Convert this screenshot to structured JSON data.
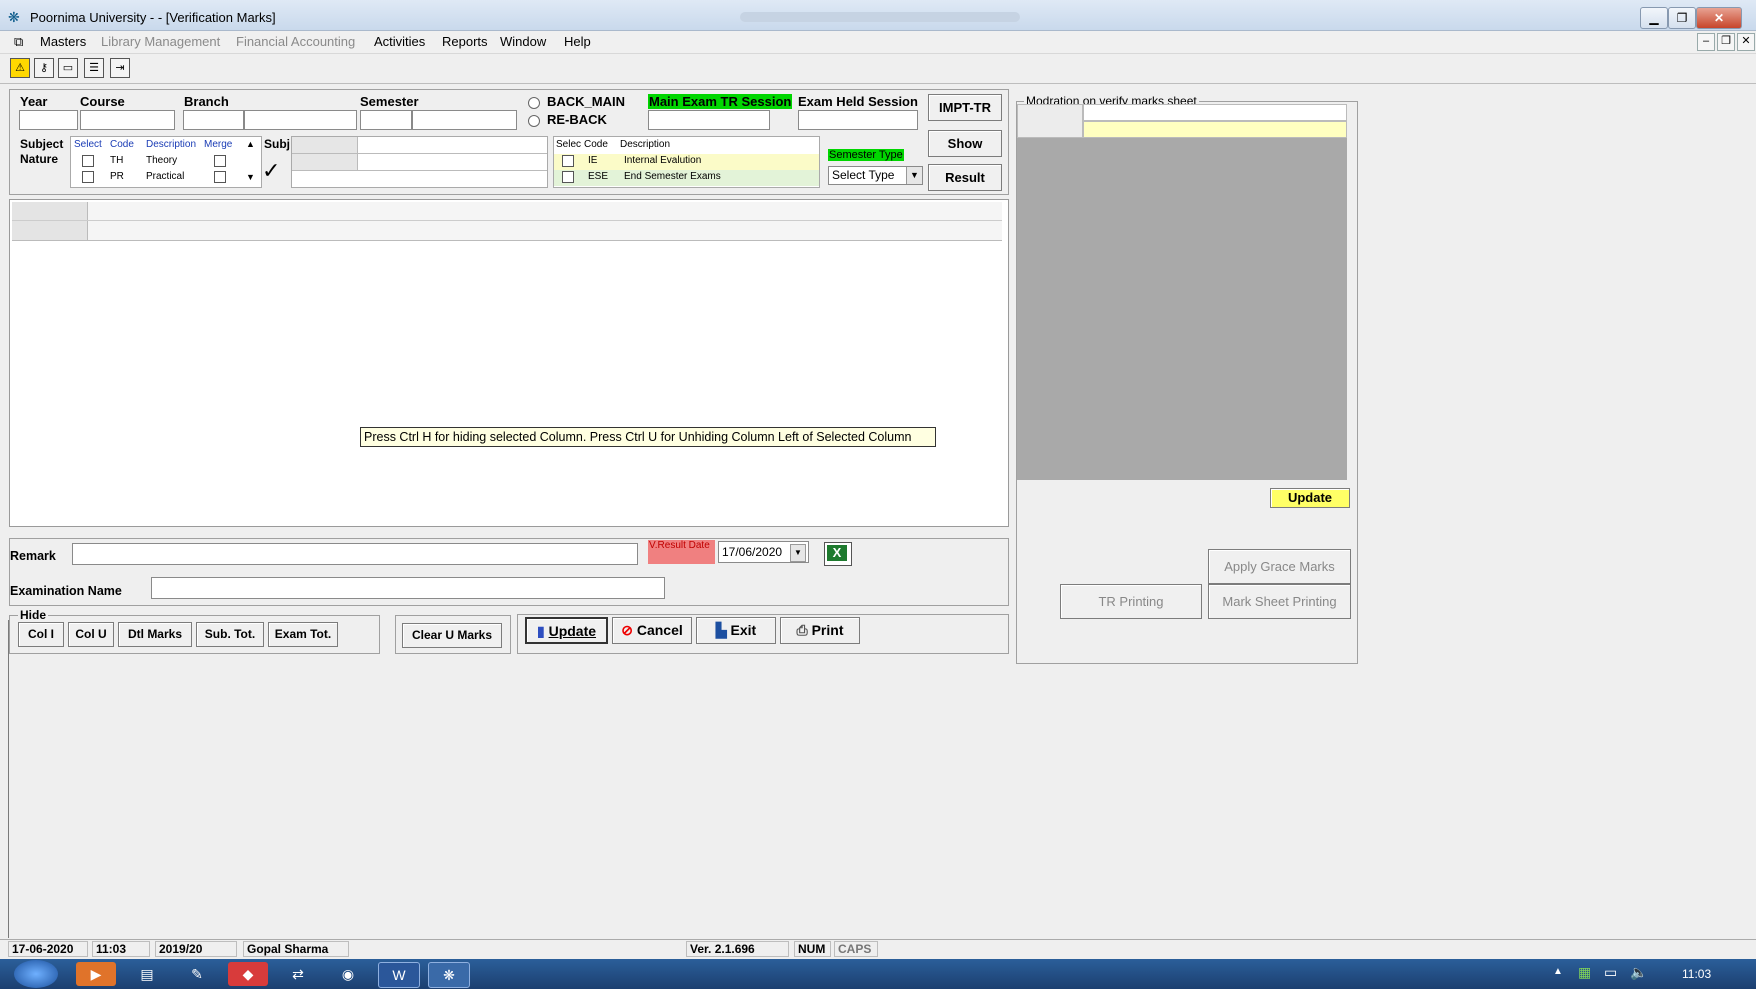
{
  "window": {
    "title": "Poornima University -  - [Verification Marks]"
  },
  "menu": [
    "Masters",
    "Library Management",
    "Financial Accounting",
    "Activities",
    "Reports",
    "Window",
    "Help"
  ],
  "filters": {
    "year_label": "Year",
    "course_label": "Course",
    "branch_label": "Branch",
    "semester_label": "Semester",
    "radio_back_main": "BACK_MAIN",
    "radio_re_back": "RE-BACK",
    "main_exam_session_label": "Main Exam TR Session",
    "exam_held_session_label": "Exam Held Session",
    "impt_tr_label": "IMPT-TR",
    "show_label": "Show",
    "result_label": "Result"
  },
  "subject_nature": {
    "label_line1": "Subject",
    "label_line2": "Nature",
    "headers": [
      "Select",
      "Code",
      "Description",
      "Merge"
    ],
    "rows": [
      {
        "code": "TH",
        "description": "Theory"
      },
      {
        "code": "PR",
        "description": "Practical"
      }
    ],
    "subj_label": "Subj"
  },
  "exam_type": {
    "headers": [
      "Selec",
      "Code",
      "Description"
    ],
    "rows": [
      {
        "code": "IE",
        "description": "Internal Evalution"
      },
      {
        "code": "ESE",
        "description": "End Semester Exams"
      }
    ]
  },
  "semester_type": {
    "label": "Semester Type",
    "value": "Select Type"
  },
  "hint": "Press Ctrl H for hiding selected Column.  Press Ctrl U for Unhiding Column Left of Selected Column",
  "remark": {
    "label": "Remark",
    "value": ""
  },
  "result_date": {
    "label": "V.Result Date",
    "value": "17/06/2020"
  },
  "exam_name": {
    "label": "Examination Name",
    "value": ""
  },
  "hide": {
    "label": "Hide",
    "buttons": [
      "Col I",
      "Col U",
      "Dtl Marks",
      "Sub. Tot.",
      "Exam Tot."
    ]
  },
  "clear_u_marks": "Clear U Marks",
  "actions": {
    "update": "Update",
    "cancel": "Cancel",
    "exit": "Exit",
    "print": "Print"
  },
  "moderation": {
    "title": "Modration on verify marks sheet",
    "update_label": "Update",
    "apply_grace": "Apply Grace Marks",
    "tr_printing": "TR Printing",
    "mark_sheet_printing": "Mark Sheet Printing"
  },
  "status": {
    "date": "17-06-2020",
    "time": "11:03",
    "session": "2019/20",
    "user": "Gopal Sharma",
    "version": "Ver. 2.1.696",
    "num": "NUM",
    "caps": "CAPS"
  },
  "taskbar": {
    "clock": "11:03"
  },
  "colors": {
    "green_label": "#00d600",
    "yellow_row": "#fbfbc8",
    "grey_panel": "#a9a9a9",
    "red_label": "#f08080",
    "update_yellow": "#ffff66"
  }
}
